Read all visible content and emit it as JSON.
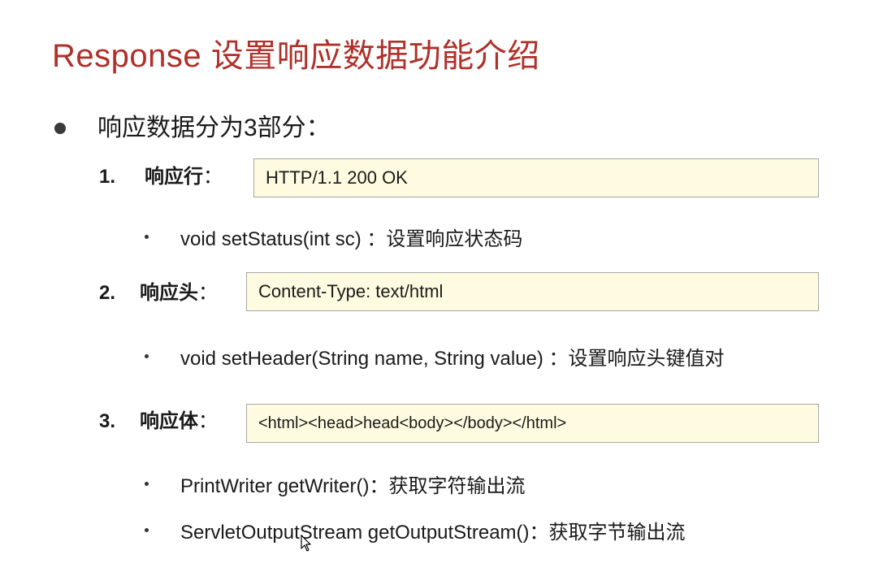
{
  "title": "Response 设置响应数据功能介绍",
  "main_bullet": "响应数据分为3部分：",
  "sections": [
    {
      "number": "1.",
      "label": "响应行",
      "colon": "：",
      "example": "HTTP/1.1 200 OK",
      "methods": [
        "void setStatus(int sc) ：设置响应状态码"
      ]
    },
    {
      "number": "2.",
      "label": "响应头",
      "colon": "：",
      "example": "Content-Type: text/html",
      "methods": [
        "void setHeader(String name, String value) ：设置响应头键值对"
      ]
    },
    {
      "number": "3.",
      "label": "响应体",
      "colon": "：",
      "example": "<html><head>head<body></body></html>",
      "methods": [
        "PrintWriter getWriter()：获取字符输出流",
        "ServletOutputStream getOutputStream()：获取字节输出流"
      ]
    }
  ],
  "colors": {
    "title": "#b0302a",
    "box_bg": "#fffbe0",
    "box_border": "#a6a6a6",
    "text": "#1a1a1a"
  }
}
